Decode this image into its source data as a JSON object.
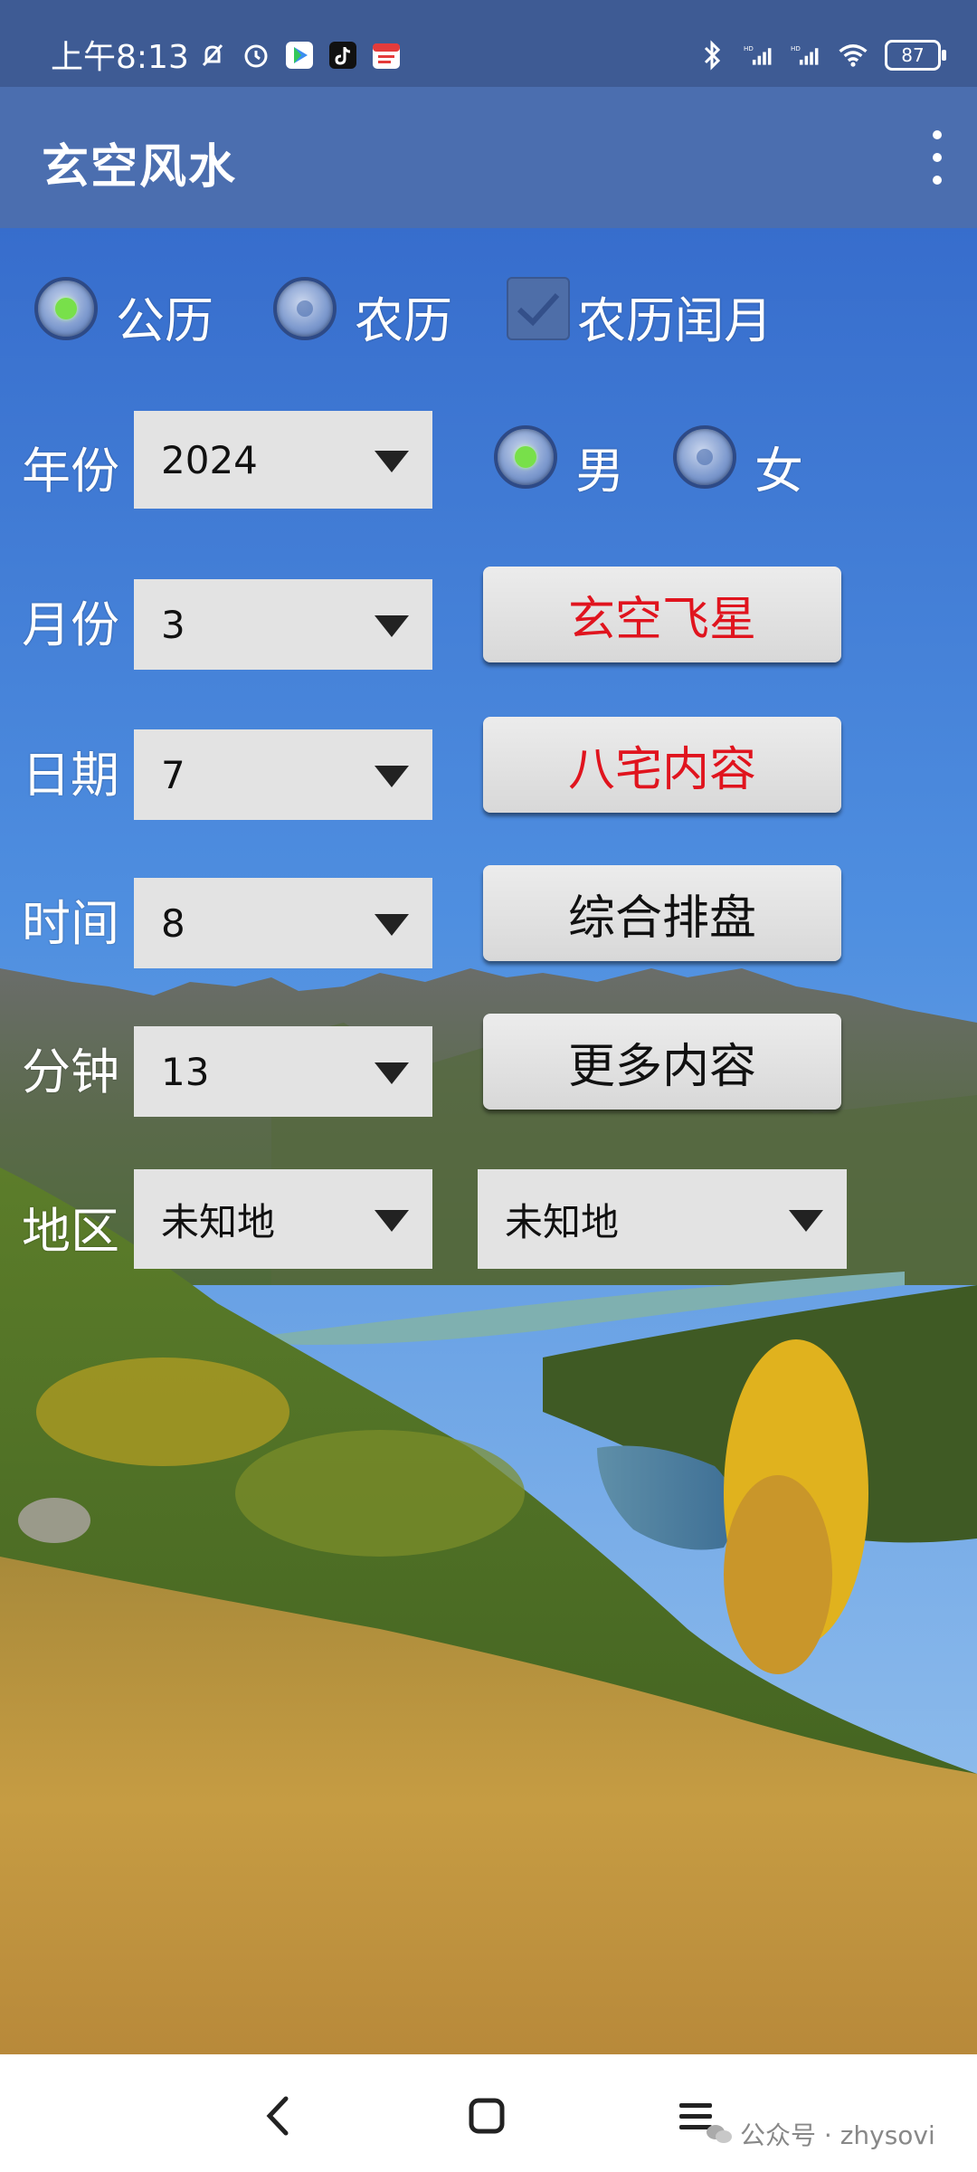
{
  "status_bar": {
    "time": "上午8:13",
    "battery": "87",
    "left_icons": [
      "bell-off-icon",
      "alarm-icon",
      "play-store-icon",
      "tiktok-icon",
      "calendar-app-icon"
    ],
    "right_icons": [
      "bluetooth-icon",
      "signal-hd-1-icon",
      "signal-hd-2-icon",
      "wifi-icon",
      "battery-icon"
    ]
  },
  "app_bar": {
    "title": "玄空风水"
  },
  "calendar_mode": {
    "solar_label": "公历",
    "lunar_label": "农历",
    "leap_label": "农历闰月",
    "selected": "solar",
    "leap_checked": true
  },
  "form": {
    "year": {
      "label": "年份",
      "value": "2024"
    },
    "month": {
      "label": "月份",
      "value": "3"
    },
    "day": {
      "label": "日期",
      "value": "7"
    },
    "hour": {
      "label": "时间",
      "value": "8"
    },
    "minute": {
      "label": "分钟",
      "value": "13"
    },
    "region": {
      "label": "地区",
      "value1": "未知地",
      "value2": "未知地"
    }
  },
  "gender": {
    "male_label": "男",
    "female_label": "女",
    "selected": "male"
  },
  "buttons": {
    "xuankong": "玄空飞星",
    "bazhai": "八宅内容",
    "zonghe": "综合排盘",
    "gengduo": "更多内容"
  },
  "colors": {
    "status_bar": "#3e5b94",
    "app_bar": "#4b6eaf",
    "button_red_text": "#e0141e",
    "button_black_text": "#111111",
    "radio_selected": "#78e04a"
  },
  "watermark": "公众号 · zhysovi"
}
